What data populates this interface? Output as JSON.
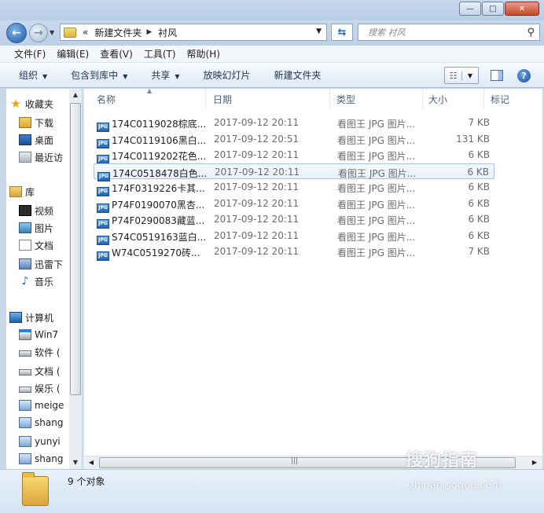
{
  "window": {
    "minimize_glyph": "—",
    "maximize_glyph": "□",
    "close_glyph": "✕"
  },
  "address": {
    "overflow": "«",
    "crumbs": [
      "新建文件夹",
      "衬风"
    ],
    "search_placeholder": "搜索 衬风"
  },
  "menu": [
    "文件(F)",
    "编辑(E)",
    "查看(V)",
    "工具(T)",
    "帮助(H)"
  ],
  "toolbar": {
    "organize": "组织",
    "include": "包含到库中",
    "share": "共享",
    "slideshow": "放映幻灯片",
    "new_folder": "新建文件夹"
  },
  "nav": {
    "favorites": "收藏夹",
    "downloads": "下载",
    "desktop": "桌面",
    "recent": "最近访",
    "libraries": "库",
    "videos": "视频",
    "pictures": "图片",
    "documents": "文档",
    "xunlei": "迅雷下",
    "music": "音乐",
    "computer": "计算机",
    "win7": "Win7",
    "software": "软件 (",
    "docs_drive": "文档 (",
    "entertainment": "娱乐 (",
    "net1": "meige",
    "net2": "shang",
    "net3": "yunyi",
    "net4": "shang"
  },
  "columns": {
    "name": "名称",
    "date": "日期",
    "type": "类型",
    "size": "大小",
    "tags": "标记"
  },
  "files": [
    {
      "name": "174C0119028棕底...",
      "date": "2017-09-12 20:11",
      "type": "看图王 JPG 图片...",
      "size": "7 KB"
    },
    {
      "name": "174C0119106黑白...",
      "date": "2017-09-12 20:51",
      "type": "看图王 JPG 图片...",
      "size": "131 KB"
    },
    {
      "name": "174C0119202花色...",
      "date": "2017-09-12 20:11",
      "type": "看图王 JPG 图片...",
      "size": "6 KB"
    },
    {
      "name": "174C0518478白色...",
      "date": "2017-09-12 20:11",
      "type": "看图王 JPG 图片...",
      "size": "6 KB"
    },
    {
      "name": "174F0319226卡其...",
      "date": "2017-09-12 20:11",
      "type": "看图王 JPG 图片...",
      "size": "6 KB"
    },
    {
      "name": "P74F0190070黑杏...",
      "date": "2017-09-12 20:11",
      "type": "看图王 JPG 图片...",
      "size": "6 KB"
    },
    {
      "name": "P74F0290083藏蓝...",
      "date": "2017-09-12 20:11",
      "type": "看图王 JPG 图片...",
      "size": "6 KB"
    },
    {
      "name": "S74C0519163蓝白...",
      "date": "2017-09-12 20:11",
      "type": "看图王 JPG 图片...",
      "size": "6 KB"
    },
    {
      "name": "W74C0519270砖...",
      "date": "2017-09-12 20:11",
      "type": "看图王 JPG 图片...",
      "size": "7 KB"
    }
  ],
  "file_icon_text": "JPG",
  "status": {
    "count": "9 个对象"
  },
  "watermark": {
    "brand": "搜狗指南",
    "url": "zhinan.sogou.com"
  }
}
